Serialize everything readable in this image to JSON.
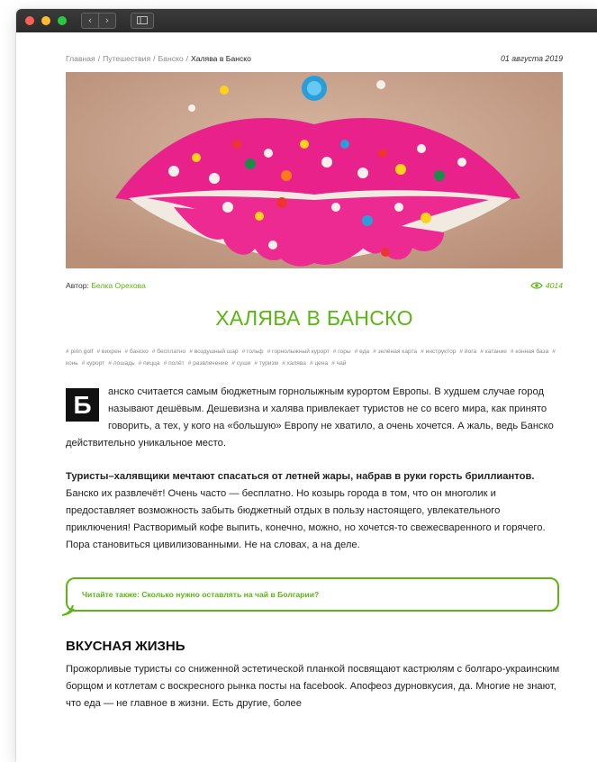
{
  "breadcrumb": {
    "items": [
      "Главная",
      "Путешествия",
      "Банско"
    ],
    "current": "Халява в Банско",
    "separator": "/"
  },
  "date": "01 августа 2019",
  "author": {
    "label": "Автор:",
    "name": "Белка Орехова"
  },
  "views": "4014",
  "title": "ХАЛЯВА В БАНСКО",
  "tags": [
    "# pirin golf",
    "# вихрен",
    "# банско",
    "# бесплатно",
    "# воздушный шар",
    "# гольф",
    "# горнолыжный курорт",
    "# горы",
    "# еда",
    "# зелёная карта",
    "# инструктор",
    "# йога",
    "# катание",
    "# конная база",
    "# конь",
    "# курорт",
    "# лошадь",
    "# пицца",
    "# полёт",
    "# развлечение",
    "# суши",
    "# туризм",
    "# халява",
    "# цена",
    "# чай"
  ],
  "lead": {
    "dropcap": "Б",
    "text": "анско считается самым бюджетным горнолыжным курортом Европы. В худшем случае город называют дешёвым. Дешевизна и халява привлекает туристов не со всего мира, как принято говорить, а тех, у кого на «большую» Европу не хватило, а очень хочется. А жаль, ведь Банско действительно уникальное место."
  },
  "paragraph1": {
    "bold": "Туристы–халявщики мечтают спасаться от летней жары, набрав в руки горсть бриллиантов.",
    "text": " Банско их развлечёт! Очень часто — бесплатно. Но козырь города в том, что он многолик и предоставляет возможность забыть бюджетный отдых в пользу настоящего, увлекательного приключения! Растворимый кофе выпить, конечно, можно, но хочется-то свежесваренного и горячего. Пора становиться цивилизованными. Не на словах, а на деле."
  },
  "read_also": "Читайте также: Сколько нужно оставлять на чай в Болгарии?",
  "section": {
    "heading": "ВКУСНАЯ ЖИЗНЬ",
    "text": "Прожорливые туристы со сниженной эстетической планкой посвящают кастрюлям с болгаро-украинским борщом и котлетам с воскресного рынка посты на facebook. Апофеоз дурновкусия, да. Многие не знают, что еда — не главное в жизни. Есть другие, более"
  },
  "colors": {
    "accent": "#5bb512",
    "dropcap_bg": "#111111"
  },
  "icons": {
    "views": "eye-icon",
    "back": "chevron-left-icon",
    "forward": "chevron-right-icon",
    "sidebar": "sidebar-icon"
  }
}
